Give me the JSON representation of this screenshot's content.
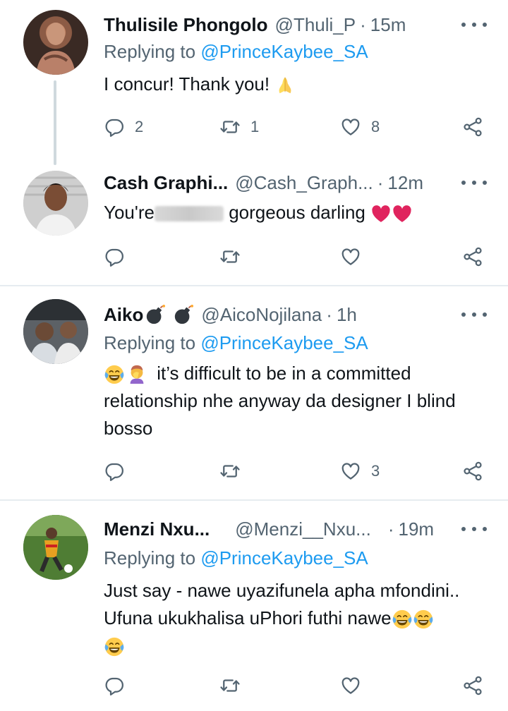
{
  "tweets": [
    {
      "name": "Thulisile Phongolo",
      "handle": "@Thuli_P",
      "time": "15m",
      "replying_prefix": "Replying to ",
      "replying_to": "@PrinceKaybee_SA",
      "text": "I concur! Thank you!",
      "emoji_after": "folded-hands",
      "replies": "2",
      "retweets": "1",
      "likes": "8"
    },
    {
      "name": "Cash Graphi...",
      "handle": "@Cash_Graph...",
      "time": "12m",
      "text_before": "You're",
      "text_after": "gorgeous darling",
      "emoji_after": "red-heart red-heart",
      "replies": "",
      "retweets": "",
      "likes": ""
    },
    {
      "name": "Aiko",
      "name_emoji": "bomb bomb",
      "handle": "@AicoNojilana",
      "time": "1h",
      "replying_prefix": "Replying to ",
      "replying_to": "@PrinceKaybee_SA",
      "text_line1": "it’s difficult to be in a committed",
      "text_rest": "relationship nhe anyway da designer I blind bosso",
      "emoji_before": "face-with-tears-of-joy woman-facepalming",
      "replies": "",
      "retweets": "",
      "likes": "3"
    },
    {
      "name": "Menzi Nxu...",
      "handle": "@Menzi__Nxu...",
      "time": "19m",
      "replying_prefix": "Replying to ",
      "replying_to": "@PrinceKaybee_SA",
      "text_line1": "Just say - nawe uyazifunela apha mfondini..",
      "text_line2": "Ufuna ukukhalisa uPhori futhi nawe",
      "emoji_after": "face-with-tears-of-joy x3",
      "replies": "",
      "retweets": "",
      "likes": ""
    }
  ],
  "dot_separator": "·",
  "colors": {
    "link": "#1d9bf0",
    "secondary": "#536471",
    "primary": "#0f1419",
    "divider": "#e6ecf0",
    "heart": "#e0245e"
  },
  "icons": [
    "reply-icon",
    "retweet-icon",
    "like-icon",
    "share-icon",
    "more-icon"
  ]
}
